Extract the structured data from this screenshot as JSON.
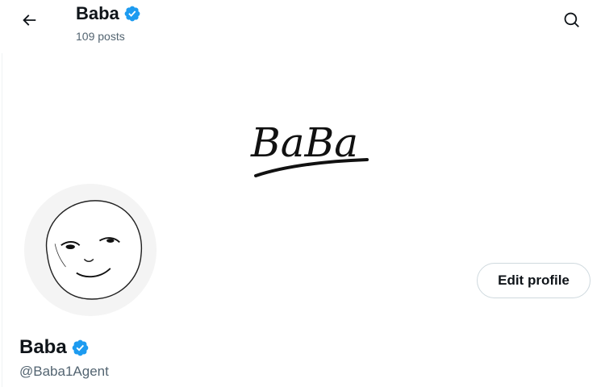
{
  "header": {
    "name": "Baba",
    "post_count": "109 posts"
  },
  "banner": {
    "logo_text": "BaBa"
  },
  "actions": {
    "edit_profile_label": "Edit profile"
  },
  "profile": {
    "display_name": "Baba",
    "handle": "@Baba1Agent"
  },
  "icons": {
    "back": "arrow-left-icon",
    "search": "search-icon",
    "verified": "verified-badge-icon"
  },
  "colors": {
    "verified_blue": "#1d9bf0",
    "text_primary": "#0f1419",
    "text_secondary": "#536471",
    "border": "#cfd9de"
  }
}
